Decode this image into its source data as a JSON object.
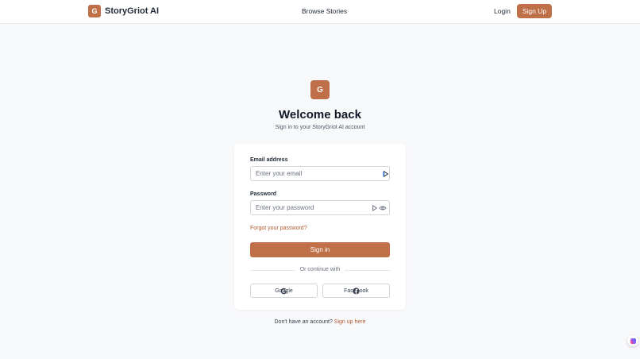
{
  "header": {
    "logo_letter": "G",
    "brand_name": "StoryGriot AI",
    "nav_browse": "Browse Stories",
    "login": "Login",
    "signup": "Sign Up"
  },
  "hero": {
    "logo_letter": "G",
    "title": "Welcome back",
    "subtitle": "Sign in to your StoryGriot AI account"
  },
  "form": {
    "email_label": "Email address",
    "email_placeholder": "Enter your email",
    "password_label": "Password",
    "password_placeholder": "Enter your password",
    "forgot": "Forgot your password?",
    "signin": "Sign in",
    "divider": "Or continue with",
    "google": "Google",
    "facebook": "Facebook"
  },
  "footer": {
    "no_account": "Don't have an account?",
    "signup_link": "Sign up here"
  },
  "colors": {
    "accent": "#c07048",
    "link": "#b45a30",
    "background": "#f8f9fb"
  },
  "icons": [
    "password-manager-icon",
    "eye-icon",
    "google-icon",
    "facebook-icon",
    "assistant-widget-icon"
  ]
}
